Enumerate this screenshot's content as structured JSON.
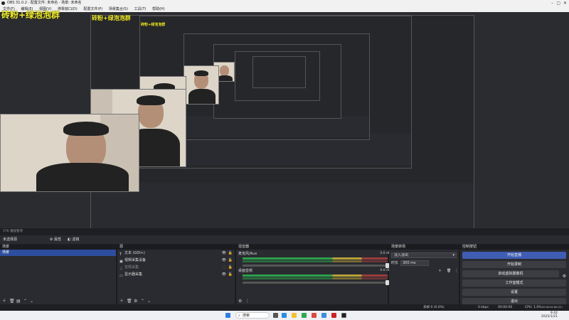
{
  "window": {
    "title": "OBS 31.0.2 - 配置文件: 未命名 - 场景: 未命名",
    "menu": [
      "文件(F)",
      "编辑(E)",
      "视图(V)",
      "停靠窗口(D)",
      "配置文件(P)",
      "场景集合(S)",
      "工具(T)",
      "帮助(H)"
    ]
  },
  "preview": {
    "overlay_text": "砖粉+绿泡泡群"
  },
  "status_line": "57K  播放暂停",
  "toolbar": {
    "scene_label": "未选择源",
    "properties": "⚙ 属性",
    "filters": "◧ 滤镜"
  },
  "scenes_dock": {
    "title": "场景",
    "items": [
      {
        "label": "场景"
      }
    ]
  },
  "sources_dock": {
    "title": "源",
    "items": [
      {
        "icon": "T",
        "label": "文本 (GDI+)"
      },
      {
        "icon": "▣",
        "label": "视频采集设备"
      },
      {
        "icon": "♫",
        "label": "音频采集"
      },
      {
        "icon": "▭",
        "label": "显示器采集"
      }
    ]
  },
  "mixer_dock": {
    "title": "混音器",
    "tracks": [
      {
        "name": "麦克风/Aux",
        "db": "0.0 dB"
      },
      {
        "name": "桌面音频",
        "db": "0.0 dB"
      }
    ]
  },
  "transitions_dock": {
    "title": "场景转场",
    "transition": "淡入淡出",
    "duration_label": "时长",
    "duration_value": "300 ms"
  },
  "controls_dock": {
    "title": "控制按钮",
    "buttons": [
      "开始直播",
      "开始录制",
      "启动虚拟摄像机",
      "工作室模式",
      "设置",
      "退出"
    ]
  },
  "statusbar": {
    "dropped": "丢帧 0 (0.0%)",
    "cpu": "CPU: 1.0%",
    "fps": "00:00:00  60.00 / 60.00 FPS",
    "rec": "00:00:00",
    "kbps": "0 kbps"
  },
  "taskbar": {
    "search": "搜索",
    "time": "9:42",
    "date": "2025/1/21"
  },
  "colors": {
    "overlay": "#f3ee2c",
    "selected": "#2d4d9e",
    "primary_button": "#3f5db3"
  }
}
